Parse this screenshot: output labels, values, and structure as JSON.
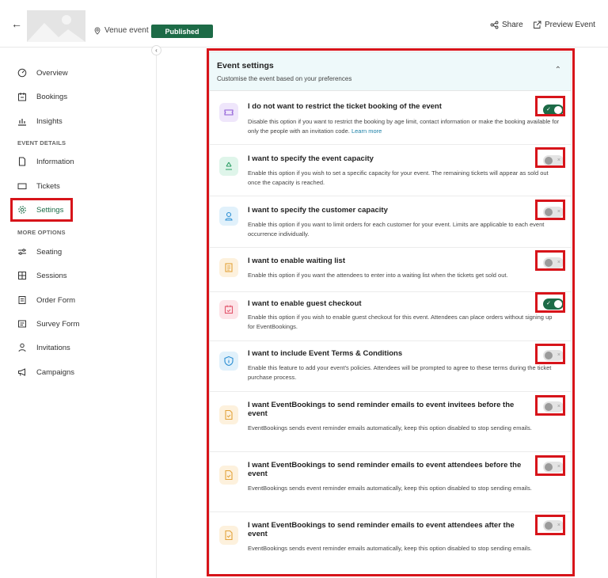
{
  "header": {
    "back_icon": "arrow-left-icon",
    "venue_label": "Venue event",
    "status_badge": "Published",
    "share_label": "Share",
    "preview_label": "Preview Event",
    "badge_color": "#1d6b47"
  },
  "sidebar": {
    "collapse_icon": "chevron-left-icon",
    "items_top": [
      {
        "label": "Overview",
        "icon": "gauge-icon"
      },
      {
        "label": "Bookings",
        "icon": "calendar-icon"
      },
      {
        "label": "Insights",
        "icon": "bar-chart-icon"
      }
    ],
    "section_event_details": "EVENT DETAILS",
    "items_details": [
      {
        "label": "Information",
        "icon": "document-icon"
      },
      {
        "label": "Tickets",
        "icon": "ticket-icon"
      },
      {
        "label": "Settings",
        "icon": "gear-icon"
      }
    ],
    "section_more_options": "MORE OPTIONS",
    "items_more": [
      {
        "label": "Seating",
        "icon": "sliders-icon"
      },
      {
        "label": "Sessions",
        "icon": "grid-icon"
      },
      {
        "label": "Order Form",
        "icon": "form-icon"
      },
      {
        "label": "Survey Form",
        "icon": "survey-icon"
      },
      {
        "label": "Invitations",
        "icon": "user-icon"
      },
      {
        "label": "Campaigns",
        "icon": "megaphone-icon"
      }
    ]
  },
  "settings": {
    "title": "Event settings",
    "subtitle": "Customise the event based on your preferences",
    "options": [
      {
        "title": "I do not want to restrict the ticket booking of the event",
        "desc": "Disable this option if you want to restrict the booking by age limit, contact information or make the booking available for only the people with an invitation code.",
        "link": "Learn more",
        "enabled": true,
        "icon": "ticket-icon",
        "icon_bg": "#efe6fb",
        "icon_color": "#8e5bd6"
      },
      {
        "title": "I want to specify the event capacity",
        "desc": "Enable this option if you wish to set a specific capacity for your event. The remaining tickets will appear as sold out once the capacity is reached.",
        "enabled": false,
        "icon": "recycle-icon",
        "icon_bg": "#dff5ea",
        "icon_color": "#2a9d63"
      },
      {
        "title": "I want to specify the customer capacity",
        "desc": "Enable this option if you want to limit orders for each customer for your event. Limits are applicable to each event occurrence individually.",
        "enabled": false,
        "icon": "person-icon",
        "icon_bg": "#e1f1fb",
        "icon_color": "#2b8ed3"
      },
      {
        "title": "I want to enable waiting list",
        "desc": "Enable this option if you want the attendees to enter into a waiting list when the tickets get sold out.",
        "enabled": false,
        "icon": "list-icon",
        "icon_bg": "#fdf1dd",
        "icon_color": "#e3a23a"
      },
      {
        "title": "I want to enable guest checkout",
        "desc": "Enable this option if you wish to enable guest checkout for this event. Attendees can place orders without signing up for EventBookings.",
        "enabled": true,
        "icon": "calendar-check-icon",
        "icon_bg": "#fde4e8",
        "icon_color": "#e2566c"
      },
      {
        "title": "I want to include Event Terms & Conditions",
        "desc": "Enable this feature to add your event's policies. Attendees will be prompted to agree to these terms during the ticket purchase process.",
        "enabled": false,
        "icon": "info-icon",
        "icon_bg": "#e1f1fb",
        "icon_color": "#2b8ed3"
      },
      {
        "title": "I want EventBookings to send reminder emails to event invitees before the event",
        "desc": "EventBookings sends event reminder emails automatically, keep this option disabled to stop sending emails.",
        "enabled": false,
        "icon": "file-check-icon",
        "icon_bg": "#fdf1dd",
        "icon_color": "#e3a23a"
      },
      {
        "title": "I want EventBookings to send reminder emails to event attendees before the event",
        "desc": "EventBookings sends event reminder emails automatically, keep this option disabled to stop sending emails.",
        "enabled": false,
        "icon": "file-check-icon",
        "icon_bg": "#fdf1dd",
        "icon_color": "#e3a23a"
      },
      {
        "title": "I want EventBookings to send reminder emails to event attendees after the event",
        "desc": "EventBookings sends event reminder emails automatically, keep this option disabled to stop sending emails.",
        "enabled": false,
        "icon": "file-check-icon",
        "icon_bg": "#fdf1dd",
        "icon_color": "#e3a23a"
      }
    ]
  }
}
